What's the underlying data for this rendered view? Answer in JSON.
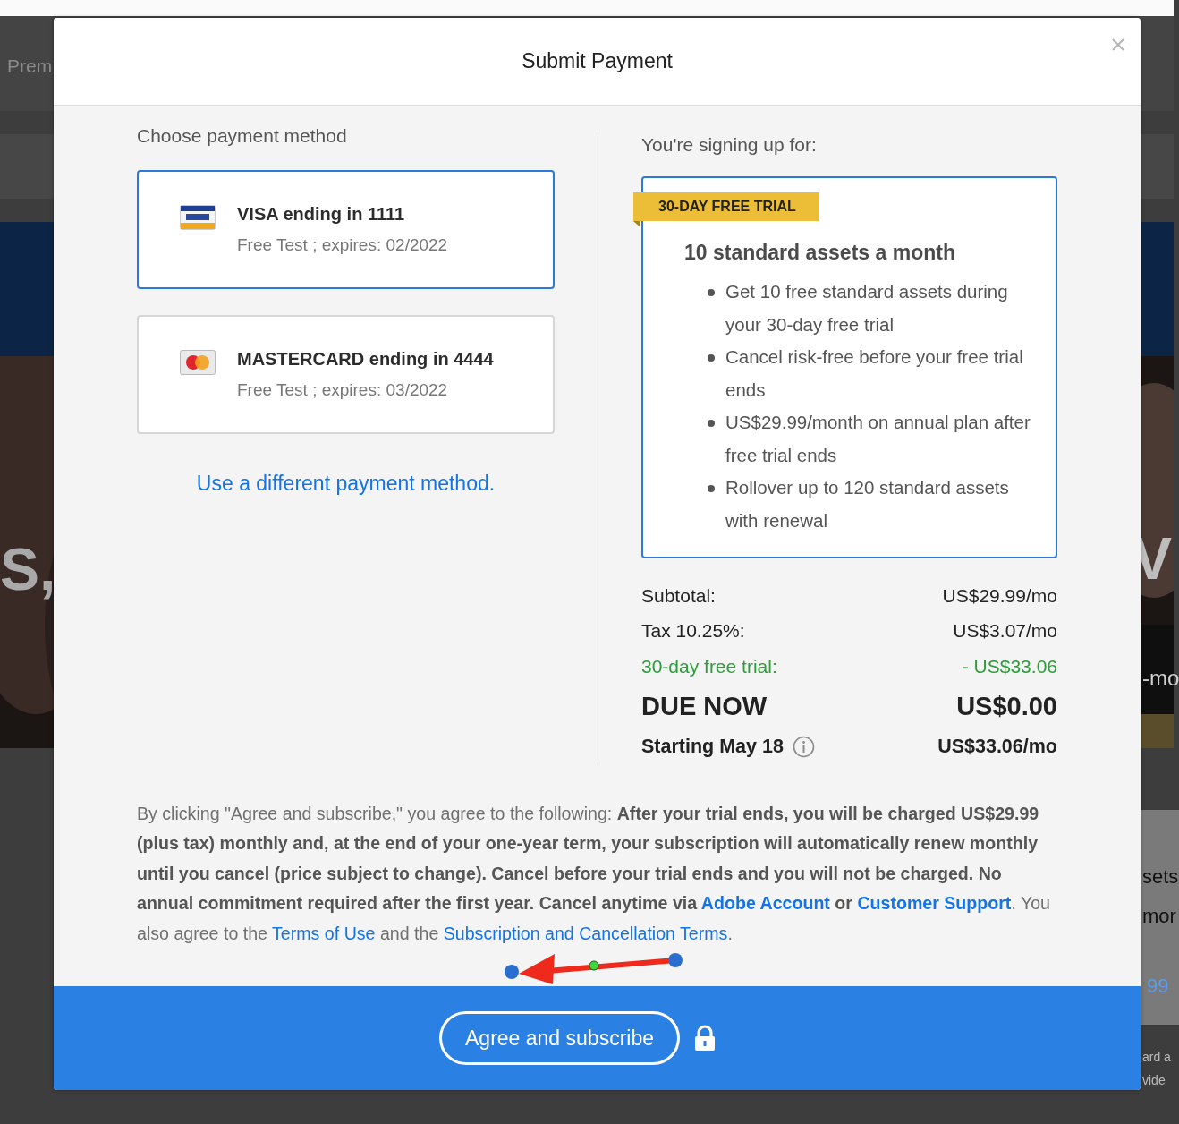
{
  "background_page": {
    "texts": [
      {
        "text": "Prem"
      },
      {
        "text": "S,"
      },
      {
        "text": "V"
      },
      {
        "text": "-mo"
      },
      {
        "text": "sets"
      },
      {
        "text": "mor"
      },
      {
        "text": "99"
      },
      {
        "text": "ard a"
      },
      {
        "text": "vide"
      }
    ]
  },
  "dialog": {
    "title": "Submit Payment",
    "payment": {
      "heading": "Choose payment method",
      "methods": [
        {
          "kind": "visa",
          "title": "VISA ending in 1111",
          "detail": "Free Test ; expires: 02/2022",
          "selected": true
        },
        {
          "kind": "mastercard",
          "title": "MASTERCARD ending in 4444",
          "detail": "Free Test ; expires: 03/2022",
          "selected": false
        }
      ],
      "other_link": "Use a different payment method."
    },
    "plan": {
      "heading": "You're signing up for:",
      "badge": "30-DAY FREE TRIAL",
      "title": "10 standard assets a month",
      "features": [
        "Get 10 free standard assets during your 30-day free trial",
        "Cancel risk-free before your free trial ends",
        "US$29.99/month on annual plan after free trial ends",
        "Rollover up to 120 standard assets with renewal"
      ]
    },
    "totals": [
      {
        "kind": "normal",
        "label": "Subtotal:",
        "value": "US$29.99/mo"
      },
      {
        "kind": "normal",
        "label": "Tax 10.25%:",
        "value": "US$3.07/mo"
      },
      {
        "kind": "discount",
        "label": "30-day free trial:",
        "value": "- US$33.06"
      },
      {
        "kind": "due",
        "label": "DUE NOW",
        "value": "US$0.00"
      },
      {
        "kind": "future",
        "label": "Starting May 18",
        "value": "US$33.06/mo",
        "info": true
      }
    ],
    "terms": [
      {
        "kind": "text",
        "text": "By clicking \"Agree and subscribe,\" you agree to the following: "
      },
      {
        "kind": "bold",
        "text": "After your trial ends, you will be charged US$29.99 (plus tax) monthly and, at the end of your one-year term, your subscription will automatically renew monthly until you cancel (price subject to change). Cancel before your trial ends and you will not be charged. No annual commitment required after the first year. Cancel anytime via "
      },
      {
        "kind": "link",
        "bold": true,
        "text": "Adobe Account"
      },
      {
        "kind": "bold",
        "text": " or "
      },
      {
        "kind": "link",
        "bold": true,
        "text": "Customer Support"
      },
      {
        "kind": "text",
        "text": ". You also agree to the "
      },
      {
        "kind": "link",
        "bold": false,
        "text": "Terms of Use"
      },
      {
        "kind": "text",
        "text": " and the "
      },
      {
        "kind": "link",
        "bold": false,
        "text": "Subscription and Cancellation Terms"
      },
      {
        "kind": "text",
        "text": "."
      }
    ],
    "submit": "Agree and subscribe"
  }
}
